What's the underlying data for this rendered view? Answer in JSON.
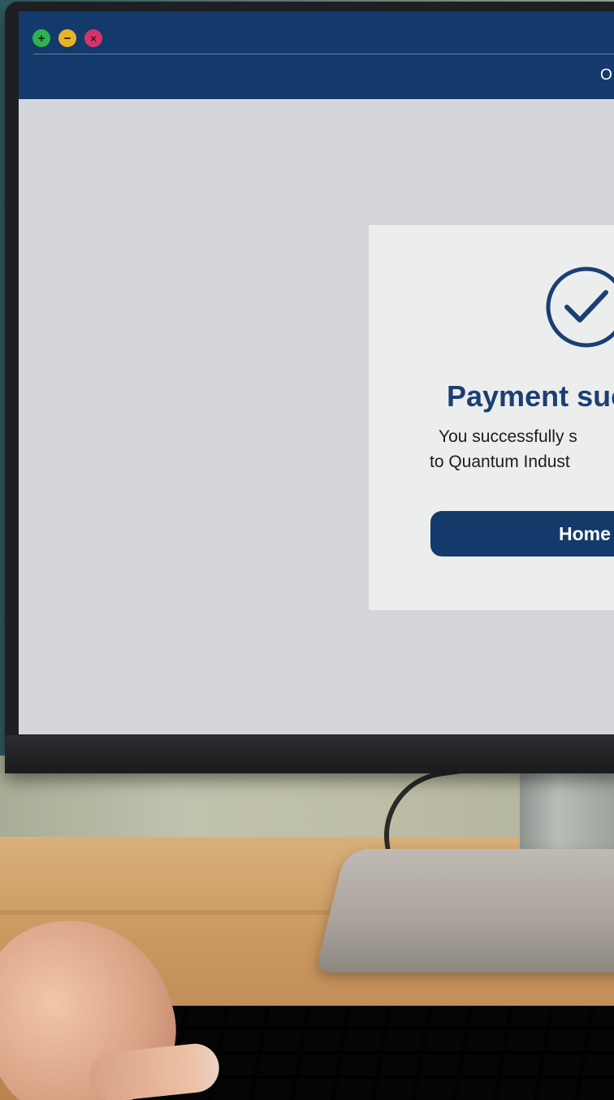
{
  "window": {
    "controls": {
      "zoom_symbol": "+",
      "minimize_symbol": "−",
      "close_symbol": "×"
    },
    "nav_partial_label": "O"
  },
  "success_card": {
    "icon": "checkmark-circle-icon",
    "title": "Payment suc",
    "message_line1": "You successfully s",
    "message_line2": "to Quantum Indust",
    "button_label": "Home"
  },
  "colors": {
    "brand_navy": "#133a6b",
    "title_blue": "#1b3f74",
    "screen_background": "#d4d6d9",
    "card_background": "#eceded",
    "traffic_green": "#2bb34f",
    "traffic_yellow": "#e8b326",
    "traffic_red": "#d6336c"
  }
}
